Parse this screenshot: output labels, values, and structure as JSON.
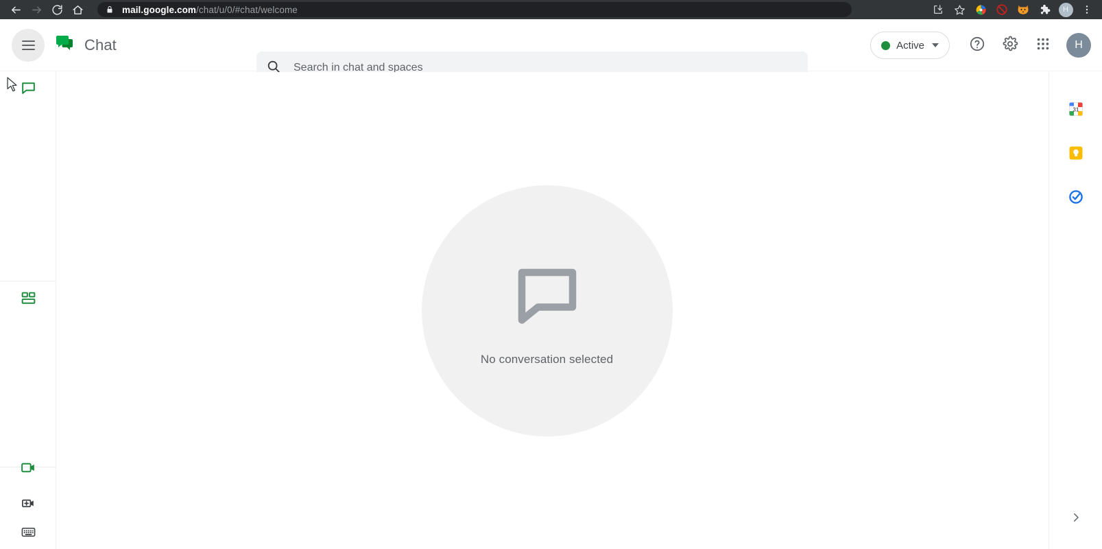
{
  "browser": {
    "back_label": "Back",
    "forward_label": "Forward",
    "reload_label": "Reload",
    "home_label": "Home",
    "url_host": "mail.google.com",
    "url_path": "/chat/u/0/#chat/welcome",
    "lock_icon": "lock-icon",
    "actions": [
      {
        "name": "install-app-icon",
        "label": "Install page as app"
      },
      {
        "name": "bookmark-star-icon",
        "label": "Bookmark this tab"
      },
      {
        "name": "color-swirl-extension-icon",
        "label": "Extension"
      },
      {
        "name": "adblock-extension-icon",
        "label": "Ad blocker"
      },
      {
        "name": "fox-extension-icon",
        "label": "Extension"
      },
      {
        "name": "puzzle-extensions-icon",
        "label": "Extensions"
      }
    ],
    "profile_initial": "H",
    "menu_label": "Customize and control"
  },
  "header": {
    "menu_label": "Main menu",
    "product_name": "Chat",
    "logo_icon": "google-chat-logo-icon",
    "search": {
      "placeholder": "Search in chat and spaces",
      "value": "",
      "icon": "search-icon"
    },
    "status": {
      "label": "Active",
      "dot_color": "#1e8e3e",
      "caret_icon": "chevron-down-icon"
    },
    "help_label": "Support",
    "settings_label": "Settings",
    "apps_label": "Google apps",
    "avatar_initial": "H"
  },
  "left_rail": {
    "items": [
      {
        "name": "rail-item-chat",
        "label": "Chat",
        "icon": "chat-bubble-icon",
        "active": true
      },
      {
        "name": "rail-item-spaces",
        "label": "Spaces",
        "icon": "spaces-grid-icon",
        "active": false
      }
    ],
    "bottom_items": [
      {
        "name": "rail-item-meet",
        "label": "Meet",
        "icon": "video-camera-icon"
      },
      {
        "name": "rail-item-new-meeting",
        "label": "New meeting",
        "icon": "video-camera-plus-icon"
      },
      {
        "name": "rail-item-join-with-code",
        "label": "Join with a code",
        "icon": "keyboard-icon"
      }
    ]
  },
  "main": {
    "empty_state": {
      "icon": "chat-bubble-outline-icon",
      "text": "No conversation selected"
    }
  },
  "side_panel": {
    "items": [
      {
        "name": "side-panel-calendar",
        "label": "Calendar",
        "icon": "google-calendar-icon",
        "badge": "31"
      },
      {
        "name": "side-panel-keep",
        "label": "Keep",
        "icon": "google-keep-icon"
      },
      {
        "name": "side-panel-tasks",
        "label": "Tasks",
        "icon": "google-tasks-icon"
      }
    ],
    "expand_label": "Show side panel",
    "expand_icon": "chevron-right-icon"
  },
  "colors": {
    "chrome_bar": "#323639",
    "omnibox": "#202124",
    "brand_green": "#1e8e3e",
    "chat_green": "#00ac47",
    "text_primary": "#3c4043",
    "text_secondary": "#5f6368",
    "search_bg": "#f1f3f4",
    "empty_circle": "#f1f1f2"
  }
}
